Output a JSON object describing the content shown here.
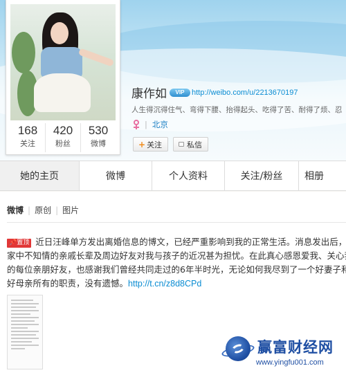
{
  "profile": {
    "name": "康作如",
    "vip_badge": "VIP",
    "url": "http://weibo.com/u/2213670197",
    "bio": "人生得沉得住气、弯得下腰、抬得起头、吃得了苦、耐得了烦、忍",
    "location": "北京",
    "follow_button": "关注",
    "message_button": "私信"
  },
  "stats": [
    {
      "value": "168",
      "label": "关注"
    },
    {
      "value": "420",
      "label": "粉丝"
    },
    {
      "value": "530",
      "label": "微博"
    }
  ],
  "tabs": [
    {
      "label": "她的主页",
      "active": true
    },
    {
      "label": "微博"
    },
    {
      "label": "个人资料"
    },
    {
      "label": "关注/粉丝"
    },
    {
      "label": "相册"
    }
  ],
  "subnav": {
    "weibo": "微博",
    "original": "原创",
    "images": "图片"
  },
  "post": {
    "pin_label": "置顶",
    "line1": "近日汪峰单方发出离婚信息的博文，已经严重影响到我的正常生活。消息发出后，",
    "line2": "家中不知情的亲戚长辈及周边好友对我与孩子的近况甚为担忧。在此真心感恩爱我、关心我",
    "line3_text": "的每位亲朋好友，也感谢我们曾经共同走过的6年半时光，无论如何我尽到了一个好妻子和",
    "line4_text": "好母亲所有的职责，没有遗憾。",
    "link": "http://t.cn/z8d8CPd"
  },
  "watermark": {
    "cn": "赢富财经网",
    "en": "www.yingfu001.com"
  }
}
